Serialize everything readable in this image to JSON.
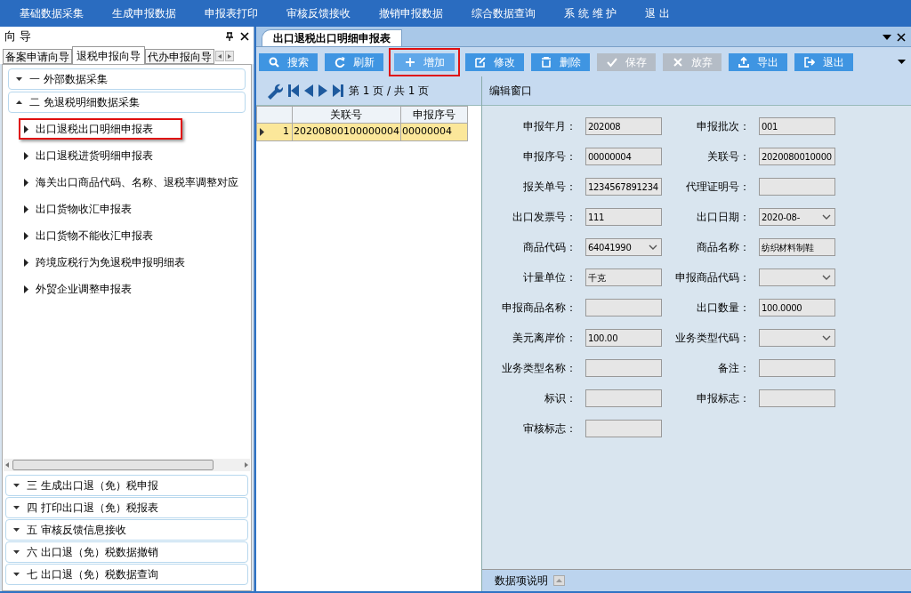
{
  "menu": [
    "基础数据采集",
    "生成申报数据",
    "申报表打印",
    "审核反馈接收",
    "撤销申报数据",
    "综合数据查询",
    "系 统 维 护",
    "退 出"
  ],
  "guide_panel": {
    "title": "向 导",
    "tabs": [
      {
        "label": "备案申请向导",
        "selected": false
      },
      {
        "label": "退税申报向导",
        "selected": true
      },
      {
        "label": "代办申报向导",
        "selected": false
      }
    ],
    "sections": [
      {
        "label": "一  外部数据采集",
        "expanded": false
      },
      {
        "label": "二  免退税明细数据采集",
        "expanded": true,
        "items": [
          {
            "label": "出口退税出口明细申报表",
            "highlighted": true
          },
          {
            "label": "出口退税进货明细申报表",
            "highlighted": false
          },
          {
            "label": "海关出口商品代码、名称、退税率调整对应",
            "highlighted": false
          },
          {
            "label": "出口货物收汇申报表",
            "highlighted": false
          },
          {
            "label": "出口货物不能收汇申报表",
            "highlighted": false
          },
          {
            "label": "跨境应税行为免退税申报明细表",
            "highlighted": false
          },
          {
            "label": "外贸企业调整申报表",
            "highlighted": false
          }
        ]
      },
      {
        "label": "三  生成出口退（免）税申报",
        "expanded": false
      },
      {
        "label": "四  打印出口退（免）税报表",
        "expanded": false
      },
      {
        "label": "五  审核反馈信息接收",
        "expanded": false
      },
      {
        "label": "六  出口退（免）税数据撤销",
        "expanded": false
      },
      {
        "label": "七  出口退（免）税数据查询",
        "expanded": false
      }
    ]
  },
  "document_tab": "出口退税出口明细申报表",
  "toolbar": [
    {
      "kind": "search",
      "label": "搜索",
      "disabled": false,
      "highlighted": false
    },
    {
      "kind": "refresh",
      "label": "刷新",
      "disabled": false,
      "highlighted": false
    },
    {
      "kind": "add",
      "label": "增加",
      "disabled": false,
      "highlighted": true
    },
    {
      "kind": "edit",
      "label": "修改",
      "disabled": false,
      "highlighted": false
    },
    {
      "kind": "delete",
      "label": "删除",
      "disabled": false,
      "highlighted": false
    },
    {
      "kind": "save",
      "label": "保存",
      "disabled": true,
      "highlighted": false
    },
    {
      "kind": "cancel",
      "label": "放弃",
      "disabled": true,
      "highlighted": false
    },
    {
      "kind": "export",
      "label": "导出",
      "disabled": false,
      "highlighted": false
    },
    {
      "kind": "exit",
      "label": "退出",
      "disabled": false,
      "highlighted": false
    }
  ],
  "pager": "第 1 页 / 共 1 页",
  "grid": {
    "columns": [
      "关联号",
      "申报序号"
    ],
    "rows": [
      {
        "index": "1",
        "selected": true,
        "cells": [
          "20200800100000004",
          "00000004"
        ]
      }
    ]
  },
  "edit_window": {
    "title": "编辑窗口",
    "fields": [
      {
        "label": "申报年月：",
        "kind": "text",
        "value": "202008"
      },
      {
        "label": "申报批次：",
        "kind": "text",
        "value": "001"
      },
      {
        "label": "申报序号：",
        "kind": "text",
        "value": "00000004"
      },
      {
        "label": "关联号：",
        "kind": "text",
        "value": "2020080010000"
      },
      {
        "label": "报关单号：",
        "kind": "text",
        "value": "1234567891234"
      },
      {
        "label": "代理证明号：",
        "kind": "text"
      },
      {
        "label": "出口发票号：",
        "kind": "text",
        "value": "111"
      },
      {
        "label": "出口日期：",
        "kind": "select",
        "value": "2020-08-"
      },
      {
        "label": "商品代码：",
        "kind": "select",
        "value": "64041990"
      },
      {
        "label": "商品名称：",
        "kind": "text",
        "value": "纺织材料制鞋"
      },
      {
        "label": "计量单位：",
        "kind": "text",
        "value": "千克"
      },
      {
        "label": "申报商品代码：",
        "kind": "select"
      },
      {
        "label": "申报商品名称：",
        "kind": "text"
      },
      {
        "label": "出口数量：",
        "kind": "text",
        "value": "100.0000"
      },
      {
        "label": "美元离岸价：",
        "kind": "text",
        "value": "100.00"
      },
      {
        "label": "业务类型代码：",
        "kind": "select"
      },
      {
        "label": "业务类型名称：",
        "kind": "text"
      },
      {
        "label": "备注：",
        "kind": "text"
      },
      {
        "label": "标识：",
        "kind": "text"
      },
      {
        "label": "申报标志：",
        "kind": "text"
      },
      {
        "label": "审核标志：",
        "kind": "text"
      }
    ]
  },
  "footer": "数据项说明"
}
